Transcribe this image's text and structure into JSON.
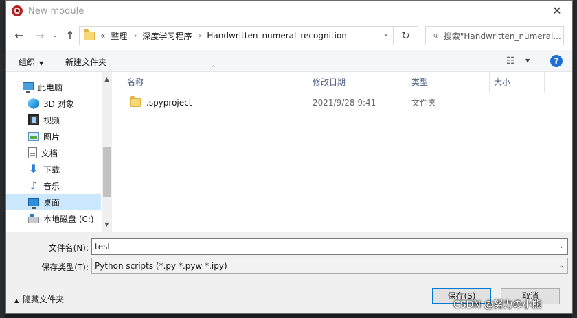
{
  "window": {
    "title": "New module",
    "close_glyph": "✕"
  },
  "nav": {
    "back_glyph": "←",
    "forward_glyph": "→",
    "recent_glyph": "⌄",
    "up_glyph": "↑",
    "breadcrumb_prefix": "«",
    "breadcrumbs": [
      "整理",
      "深度学习程序",
      "Handwritten_numeral_recognition"
    ],
    "separator": "›",
    "refresh_glyph": "↻",
    "search_placeholder": "搜索\"Handwritten_numeral..."
  },
  "toolbar": {
    "organize_label": "组织",
    "new_folder_label": "新建文件夹",
    "view_glyph": "☷",
    "help_label": "?"
  },
  "sidebar": {
    "items": [
      {
        "label": "此电脑",
        "icon": "computer-icon"
      },
      {
        "label": "3D 对象",
        "icon": "3d-objects-icon"
      },
      {
        "label": "视频",
        "icon": "video-icon"
      },
      {
        "label": "图片",
        "icon": "pictures-icon"
      },
      {
        "label": "文档",
        "icon": "documents-icon"
      },
      {
        "label": "下载",
        "icon": "download-icon"
      },
      {
        "label": "音乐",
        "icon": "music-icon"
      },
      {
        "label": "桌面",
        "icon": "desktop-icon",
        "selected": true
      },
      {
        "label": "本地磁盘 (C:)",
        "icon": "drive-icon"
      }
    ],
    "download_glyph": "⬇",
    "music_glyph": "♪"
  },
  "filelist": {
    "columns": {
      "name": "名称",
      "modified": "修改日期",
      "type": "类型",
      "size": "大小"
    },
    "rows": [
      {
        "name": ".spyproject",
        "modified": "2021/9/28 9:41",
        "type": "文件夹",
        "size": ""
      }
    ]
  },
  "form": {
    "filename_label": "文件名(N):",
    "filename_value": "test",
    "filetype_label": "保存类型(T):",
    "filetype_value": "Python scripts (*.py *.pyw *.ipy)"
  },
  "footer": {
    "hide_folders_label": "隐藏文件夹",
    "save_label": "保存(S)",
    "cancel_label": "取消"
  },
  "watermark": "CSDN @努力の小熊"
}
